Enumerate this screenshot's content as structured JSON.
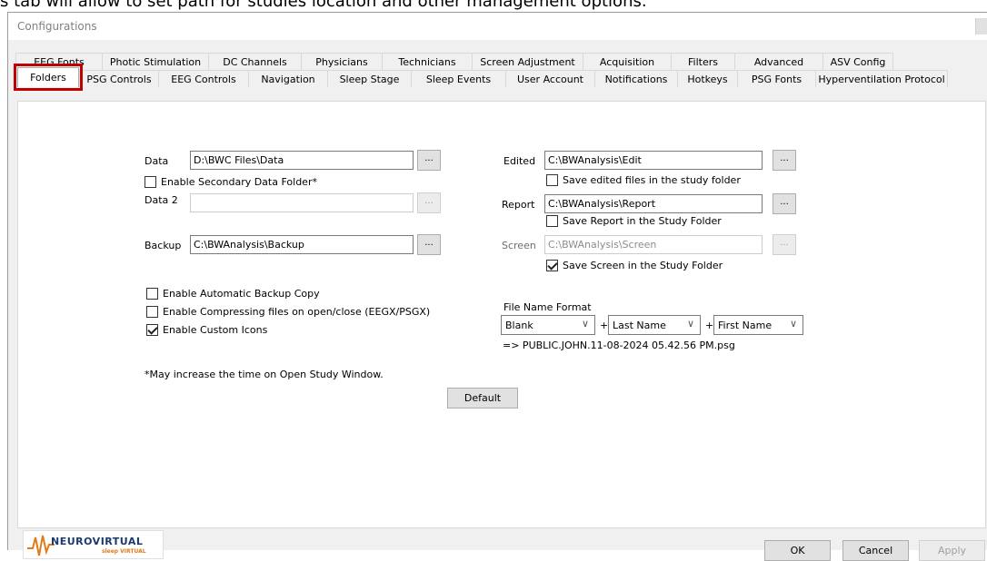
{
  "caption": "s tab will allow to set path for studies location and other management options.",
  "window": {
    "title": "Configurations"
  },
  "tabs_row1": [
    "EEG Fonts",
    "Photic Stimulation",
    "DC Channels",
    "Physicians",
    "Technicians",
    "Screen Adjustment",
    "Acquisition",
    "Filters",
    "Advanced",
    "ASV Config"
  ],
  "tabs_row2": [
    "Folders",
    "PSG Controls",
    "EEG Controls",
    "Navigation",
    "Sleep Stage",
    "Sleep Events",
    "User Account",
    "Notifications",
    "Hotkeys",
    "PSG Fonts",
    "Hyperventilation Protocol"
  ],
  "left": {
    "data_label": "Data",
    "data_value": "D:\\BWC Files\\Data",
    "enable_secondary": "Enable Secondary Data Folder*",
    "data2_label": "Data 2",
    "data2_value": "",
    "backup_label": "Backup",
    "backup_value": "C:\\BWAnalysis\\Backup",
    "auto_backup": "Enable Automatic Backup Copy",
    "compressing": "Enable Compressing files on open/close (EEGX/PSGX)",
    "custom_icons": "Enable Custom Icons",
    "note": "*May increase the time on Open Study Window."
  },
  "right": {
    "edited_label": "Edited",
    "edited_value": "C:\\BWAnalysis\\Edit",
    "save_edited": "Save edited files in the study folder",
    "report_label": "Report",
    "report_value": "C:\\BWAnalysis\\Report",
    "save_report": "Save Report in the Study Folder",
    "screen_label": "Screen",
    "screen_value": "C:\\BWAnalysis\\Screen",
    "save_screen": "Save Screen in the Study Folder",
    "file_name_format_label": "File Name Format",
    "format1": "Blank",
    "format2": "Last Name",
    "format3": "First Name",
    "plus": "+",
    "preview": "=> PUBLIC.JOHN.11-08-2024 05.42.56 PM.psg"
  },
  "browse_label": "...",
  "default_button": "Default",
  "footer": {
    "ok": "OK",
    "cancel": "Cancel",
    "apply": "Apply"
  },
  "logo": {
    "name": "NEUROVIRTUAL",
    "sub": "sleep VIRTUAL"
  },
  "colors": {
    "highlight": "#c00000",
    "accent": "#1a3a6e",
    "logo_orange": "#e07b1a"
  }
}
